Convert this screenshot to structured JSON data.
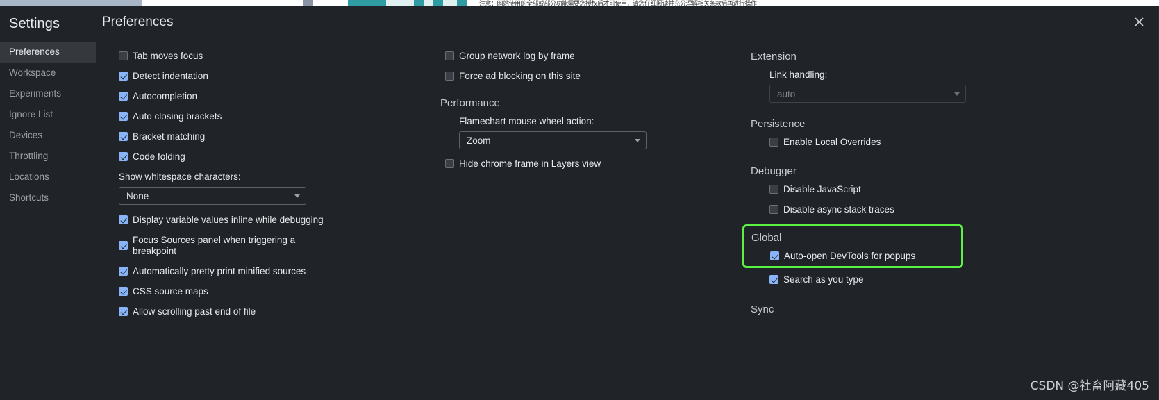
{
  "background_page": {
    "ocr_text": "注意：网站使用的全部或部分功能需要您授权后才可使用，请您仔细阅读并充分理解相关条款后再进行操作"
  },
  "colors": {
    "dialog_background": "#202327",
    "sidebar_selected": "#35383c",
    "checkbox_checked": "#8ab4f8",
    "highlight_outline": "#5cf243",
    "text_primary": "#e8eaed",
    "text_secondary": "#9aa0a6"
  },
  "sidebar": {
    "title": "Settings",
    "items": [
      {
        "label": "Preferences",
        "selected": true
      },
      {
        "label": "Workspace",
        "selected": false
      },
      {
        "label": "Experiments",
        "selected": false
      },
      {
        "label": "Ignore List",
        "selected": false
      },
      {
        "label": "Devices",
        "selected": false
      },
      {
        "label": "Throttling",
        "selected": false
      },
      {
        "label": "Locations",
        "selected": false
      },
      {
        "label": "Shortcuts",
        "selected": false
      }
    ]
  },
  "header": {
    "title": "Preferences",
    "close_icon": "close-icon"
  },
  "columns": {
    "col1": {
      "checkboxes": [
        {
          "label": "Tab moves focus",
          "checked": false
        },
        {
          "label": "Detect indentation",
          "checked": true
        },
        {
          "label": "Autocompletion",
          "checked": true
        },
        {
          "label": "Auto closing brackets",
          "checked": true
        },
        {
          "label": "Bracket matching",
          "checked": true
        },
        {
          "label": "Code folding",
          "checked": true
        }
      ],
      "whitespace_field": {
        "label": "Show whitespace characters:",
        "value": "None",
        "icon": "chevron-down-icon"
      },
      "checkboxes2": [
        {
          "label": "Display variable values inline while debugging",
          "checked": true
        },
        {
          "label": "Focus Sources panel when triggering a breakpoint",
          "checked": true
        },
        {
          "label": "Automatically pretty print minified sources",
          "checked": true
        },
        {
          "label": "CSS source maps",
          "checked": true
        },
        {
          "label": "Allow scrolling past end of file",
          "checked": true
        }
      ]
    },
    "col2": {
      "checkboxes": [
        {
          "label": "Group network log by frame",
          "checked": false
        },
        {
          "label": "Force ad blocking on this site",
          "checked": false
        }
      ],
      "performance": {
        "title": "Performance",
        "flamechart_field": {
          "label": "Flamechart mouse wheel action:",
          "value": "Zoom",
          "icon": "chevron-down-icon"
        },
        "checkboxes": [
          {
            "label": "Hide chrome frame in Layers view",
            "checked": false
          }
        ]
      }
    },
    "col3": {
      "extension": {
        "title": "Extension",
        "link_field": {
          "label": "Link handling:",
          "value": "auto",
          "icon": "chevron-down-icon",
          "disabled": true
        }
      },
      "persistence": {
        "title": "Persistence",
        "checkboxes": [
          {
            "label": "Enable Local Overrides",
            "checked": false
          }
        ]
      },
      "debugger": {
        "title": "Debugger",
        "checkboxes": [
          {
            "label": "Disable JavaScript",
            "checked": false
          },
          {
            "label": "Disable async stack traces",
            "checked": false
          }
        ]
      },
      "global": {
        "title": "Global",
        "highlighted": true,
        "checkboxes": [
          {
            "label": "Auto-open DevTools for popups",
            "checked": true
          }
        ]
      },
      "global_after": {
        "checkboxes": [
          {
            "label": "Search as you type",
            "checked": true
          }
        ]
      },
      "sync": {
        "title": "Sync"
      }
    }
  },
  "watermark": {
    "text": "CSDN @社畜阿藏405"
  }
}
